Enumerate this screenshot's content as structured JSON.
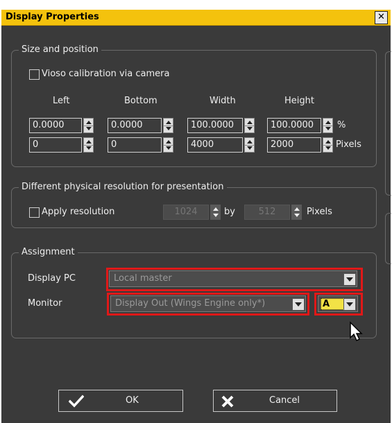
{
  "window": {
    "title": "Display Properties",
    "close_glyph": "✕"
  },
  "size_position": {
    "legend": "Size and position",
    "vioso_label": "Vioso calibration via camera",
    "vioso_checked": false,
    "columns": [
      "Left",
      "Bottom",
      "Width",
      "Height"
    ],
    "percent_values": [
      "0.0000",
      "0.0000",
      "100.0000",
      "100.0000"
    ],
    "percent_unit": "%",
    "pixel_values": [
      "0",
      "0",
      "4000",
      "2000"
    ],
    "pixel_unit": "Pixels"
  },
  "physical": {
    "legend": "Different physical resolution for presentation",
    "apply_label": "Apply resolution",
    "apply_checked": false,
    "width_value": "1024",
    "by_label": "by",
    "height_value": "512",
    "unit": "Pixels"
  },
  "assignment": {
    "legend": "Assignment",
    "display_pc_label": "Display PC",
    "display_pc_value": "Local master",
    "monitor_label": "Monitor",
    "monitor_value": "Display Out (Wings Engine only*)",
    "output_value": "A"
  },
  "buttons": {
    "ok": "OK",
    "cancel": "Cancel"
  },
  "colors": {
    "title_bar": "#f4c20d",
    "highlight": "#e01818",
    "background": "#3a3a3a"
  },
  "icons": {
    "ok": "checkmark-icon",
    "cancel": "x-icon"
  }
}
